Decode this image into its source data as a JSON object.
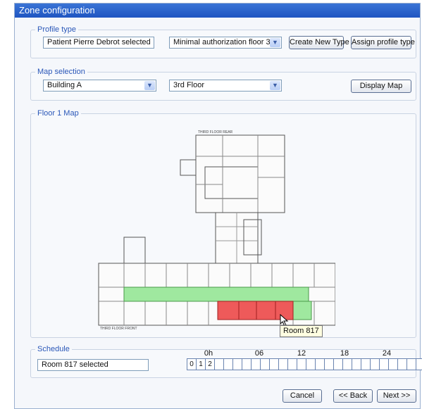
{
  "window": {
    "title": "Zone configuration"
  },
  "profile": {
    "legend": "Profile type",
    "patient_value": "Patient Pierre Debrot selected",
    "authorization_value": "Minimal authorization floor 3",
    "create_button": "Create New Type",
    "assign_button": "Assign profile type"
  },
  "map_selection": {
    "legend": "Map selection",
    "building_value": "Building A",
    "floor_value": "3rd Floor",
    "display_button": "Display Map"
  },
  "floor_map": {
    "legend": "Floor 1 Map",
    "rear_label": "THIRD FLOOR REAR",
    "front_label": "THIRD FLOOR FRONT",
    "tooltip": "Room 817"
  },
  "schedule": {
    "legend": "Schedule",
    "selected_value": "Room 817 selected",
    "hour_labels": [
      "0h",
      "06",
      "12",
      "18",
      "24"
    ],
    "slot_labels": [
      "0",
      "1",
      "2"
    ],
    "empty_slots": 24
  },
  "footer": {
    "cancel": "Cancel",
    "back": "<< Back",
    "next": "Next >>"
  },
  "colors": {
    "title_bar": "#2a60c8",
    "legend": "#2a57b8",
    "zone_green": "#8ee48e",
    "zone_red": "#ee5a5a"
  }
}
